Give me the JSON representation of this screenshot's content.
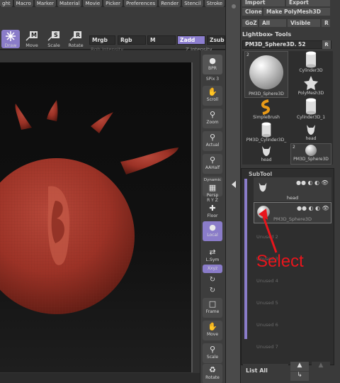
{
  "menu": [
    "ght",
    "Macro",
    "Marker",
    "Material",
    "Movie",
    "Picker",
    "Preferences",
    "Render",
    "Stencil",
    "Stroke"
  ],
  "toolbar": {
    "tools": [
      "Draw",
      "Move",
      "Scale",
      "Rotate"
    ],
    "fields": {
      "mrgb": "Mrgb",
      "rgb": "Rgb",
      "m": "M",
      "zadd": "Zadd",
      "zsub": "Zsub"
    },
    "rgb_intensity": "Rgb Intensity",
    "z_intensity": "Z Intensity"
  },
  "shelf": {
    "bpr": "BPR",
    "spix": "SPix 3",
    "scroll": "Scroll",
    "zoom": "Zoom",
    "actual": "Actual",
    "aahalf": "AAHalf",
    "dynamic": "Dynamic",
    "persp": "Persp",
    "xyz_small": "R Y Z",
    "floor": "Floor",
    "local": "Local",
    "lsym": "L.Sym",
    "xyz": "Xxyz",
    "frame": "Frame",
    "move": "Move",
    "scale": "Scale",
    "rotate": "Rotate"
  },
  "rpanel": {
    "import": "Import",
    "export": "Export",
    "clone": "Clone",
    "make_polymesh": "Make PolyMesh3D",
    "goz": "GoZ",
    "all": "All",
    "visible": "Visible",
    "r": "R",
    "lightbox_tools": "Lightbox▸ Tools",
    "current_tool": "PM3D_Sphere3D. 52",
    "tools": [
      {
        "label": "PM3D_Sphere3D",
        "badge": "2"
      },
      {
        "label": "Cylinder3D"
      },
      {
        "label": "PolyMesh3D"
      },
      {
        "label": "SimpleBrush"
      },
      {
        "label": "Cylinder3D_1"
      },
      {
        "label": "PM3D_Cylinder3D_"
      },
      {
        "label": "head"
      },
      {
        "label": "head"
      },
      {
        "label": "PM3D_Sphere3D",
        "badge": "2"
      }
    ]
  },
  "subtool": {
    "title": "SubTool",
    "slots": [
      {
        "name": "head",
        "filled": true
      },
      {
        "name": "PM3D_Sphere3D",
        "filled": true
      },
      {
        "name": "Unused 2",
        "filled": false
      },
      {
        "name": "Unused 3",
        "filled": false
      },
      {
        "name": "Unused 4",
        "filled": false
      },
      {
        "name": "Unused 5",
        "filled": false
      },
      {
        "name": "Unused 6",
        "filled": false
      },
      {
        "name": "Unused 7",
        "filled": false
      }
    ],
    "list_all": "List  All"
  },
  "annotation": {
    "text": "Select",
    "color": "#e8151c"
  },
  "colors": {
    "accent": "#8a7cc9",
    "clay": "#a8382c"
  }
}
